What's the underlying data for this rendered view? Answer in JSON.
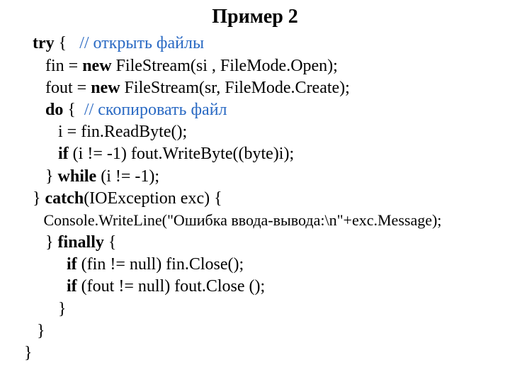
{
  "title": "Пример 2",
  "lines": {
    "l1a": "  try",
    "l1b": " {   ",
    "l1c": "// открыть файлы",
    "l2a": "     fin = ",
    "l2b": "new",
    "l2c": " FileStream(si , FileMode.Open);",
    "l3a": "     fout = ",
    "l3b": "new",
    "l3c": " FileStream(sr, FileMode.Create);",
    "l4a": "     do",
    "l4b": " {  ",
    "l4c": "// скопировать файл",
    "l5": "        i = fin.ReadByte();",
    "l6a": "        if",
    "l6b": " (i != -1) fout.WriteByte((byte)i);",
    "l7a": "     } ",
    "l7b": "while",
    "l7c": " (i != -1);",
    "l8a": "  } ",
    "l8b": "catch",
    "l8c": "(IOException exc) {",
    "l9": "     Console.WriteLine(\"Ошибка ввода-вывода:\\n\"+exc.Message);",
    "l10a": "     } ",
    "l10b": "finally",
    "l10c": " {",
    "l11a": "          if",
    "l11b": " (fin != null) fin.Close();",
    "l12a": "          if",
    "l12b": " (fout != null) fout.Close ();",
    "l13": "        }",
    "l14": "   }",
    "l15": "}"
  }
}
